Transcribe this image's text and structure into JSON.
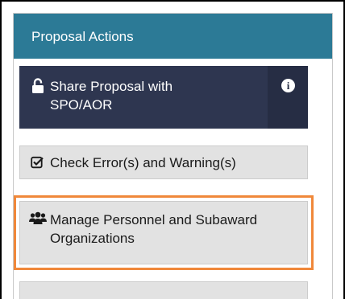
{
  "panel": {
    "title": "Proposal Actions"
  },
  "actions": {
    "share": {
      "label": "Share Proposal with\nSPO/AOR",
      "icon": "unlock-icon",
      "info_icon": "info-circle-icon",
      "info_glyph": "i"
    },
    "check": {
      "label": "Check Error(s) and Warning(s)",
      "icon": "check-square-icon"
    },
    "manage": {
      "label": "Manage Personnel and Subaward\nOrganizations",
      "icon": "users-icon",
      "highlighted": true
    }
  },
  "colors": {
    "header_bg": "#2c7a96",
    "share_bg": "#2e3650",
    "button_bg": "#e2e2e2",
    "highlight": "#f0883a"
  }
}
